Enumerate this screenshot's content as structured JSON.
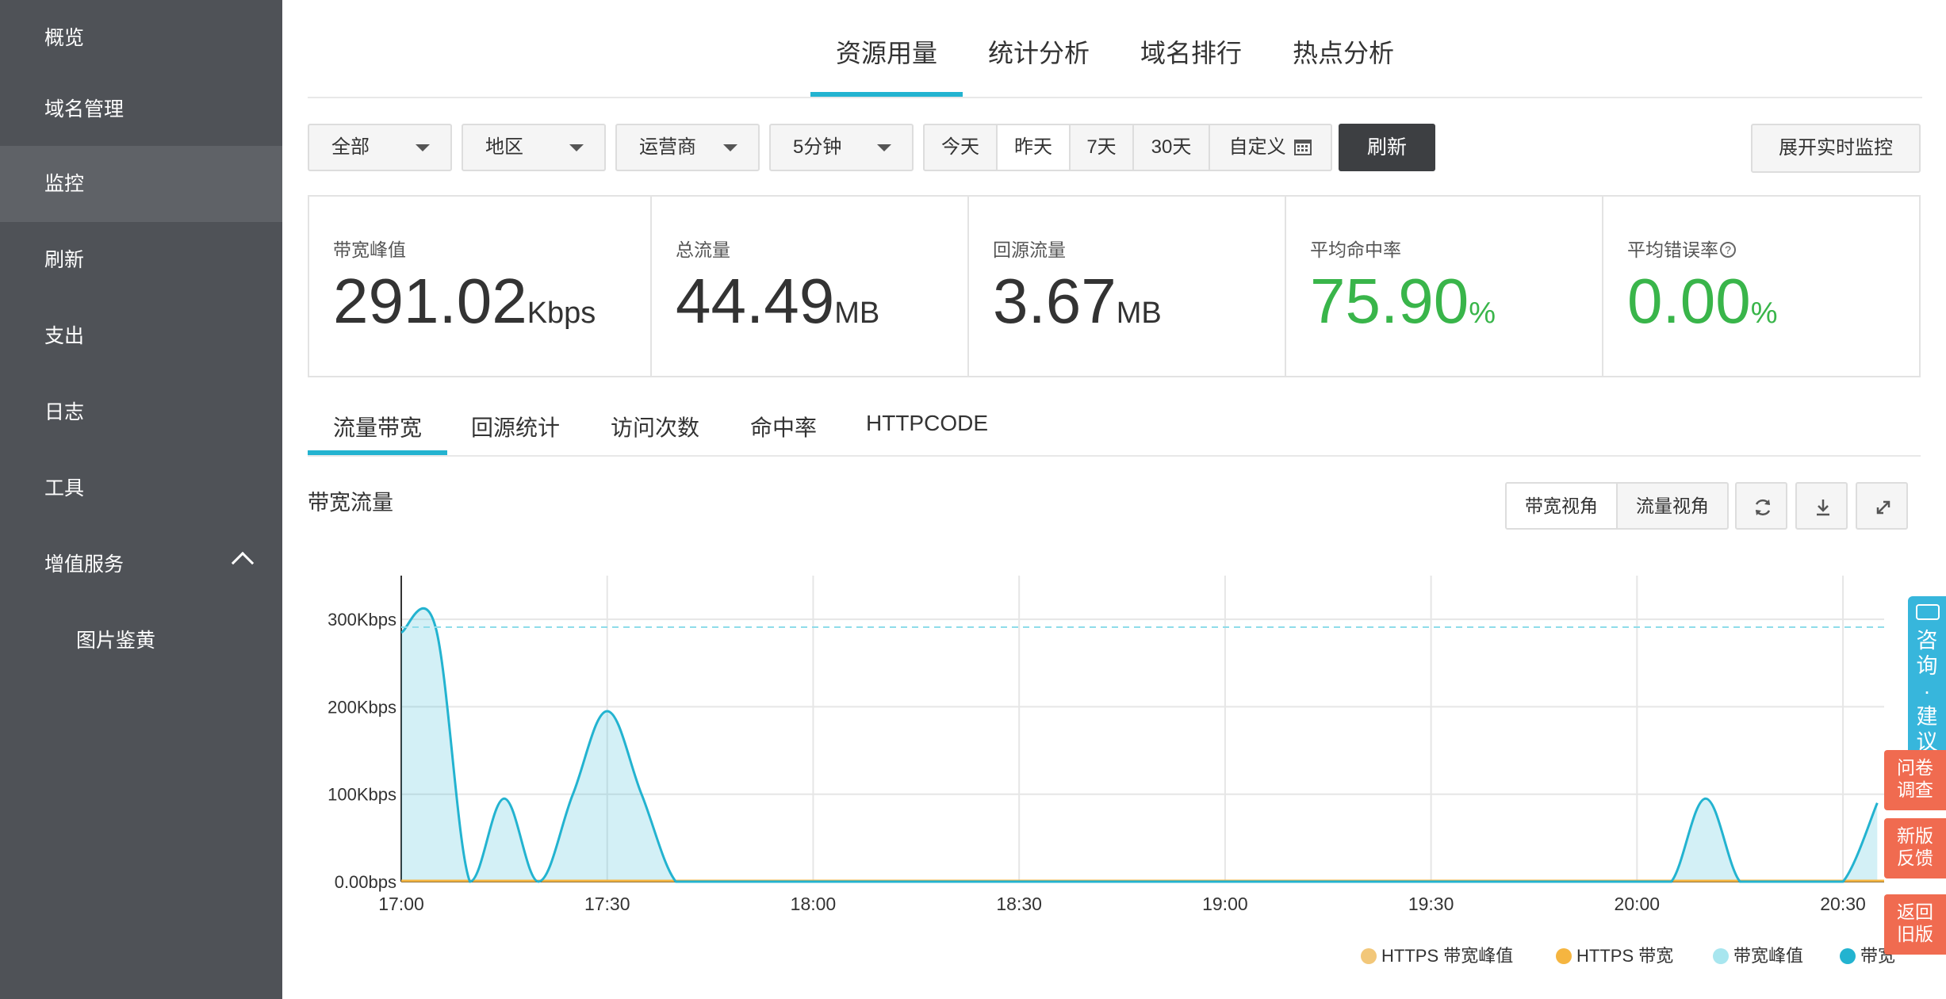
{
  "sidebar": {
    "items": [
      {
        "label": "概览"
      },
      {
        "label": "域名管理"
      },
      {
        "label": "监控"
      },
      {
        "label": "刷新"
      },
      {
        "label": "支出"
      },
      {
        "label": "日志"
      },
      {
        "label": "工具"
      },
      {
        "label": "增值服务"
      },
      {
        "label": "图片鉴黄"
      }
    ],
    "active_index": 2
  },
  "top_tabs": [
    {
      "label": "资源用量"
    },
    {
      "label": "统计分析"
    },
    {
      "label": "域名排行"
    },
    {
      "label": "热点分析"
    }
  ],
  "top_tabs_active_index": 0,
  "filters": {
    "scope": "全部",
    "region": "地区",
    "isp": "运营商",
    "interval": "5分钟"
  },
  "date_range": {
    "options": [
      "今天",
      "昨天",
      "7天",
      "30天",
      "自定义"
    ],
    "active_index": 1
  },
  "toolbar": {
    "refresh_label": "刷新",
    "realtime_label": "展开实时监控"
  },
  "stats": [
    {
      "label": "带宽峰值",
      "value": "291.02",
      "unit": "Kbps"
    },
    {
      "label": "总流量",
      "value": "44.49",
      "unit": "MB"
    },
    {
      "label": "回源流量",
      "value": "3.67",
      "unit": "MB"
    },
    {
      "label": "平均命中率",
      "value": "75.90",
      "unit": "%"
    },
    {
      "label": "平均错误率",
      "value": "0.00",
      "unit": "%"
    }
  ],
  "colors": {
    "accent": "#23b3d0",
    "good": "#39b54a",
    "sidebar_bg": "#4f5257",
    "sidebar_active_bg": "#5f6267",
    "consult_tab": "#37b6dc",
    "feedback_tab": "#f06b50"
  },
  "sub_tabs": [
    {
      "label": "流量带宽"
    },
    {
      "label": "回源统计"
    },
    {
      "label": "访问次数"
    },
    {
      "label": "命中率"
    },
    {
      "label": "HTTPCODE"
    }
  ],
  "sub_tabs_active_index": 0,
  "chart_section": {
    "title": "带宽流量",
    "view_buttons": [
      "带宽视角",
      "流量视角"
    ],
    "view_active_index": 0,
    "icons": [
      "refresh-icon",
      "download-icon",
      "fullscreen-icon"
    ]
  },
  "chart_data": {
    "type": "area",
    "title": "带宽流量",
    "xlabel": "",
    "ylabel": "",
    "x_ticks": [
      "17:00",
      "17:30",
      "18:00",
      "18:30",
      "19:00",
      "19:30",
      "20:00",
      "20:30"
    ],
    "y_ticks": [
      "0.00bps",
      "100Kbps",
      "200Kbps",
      "300Kbps"
    ],
    "ylim": [
      0,
      350
    ],
    "x_unit": "minutes after 17:00",
    "xlim": [
      0,
      216
    ],
    "grid": true,
    "legend_position": "bottom-right",
    "series": [
      {
        "name": "HTTPS 带宽峰值",
        "color": "#f2c779",
        "style": "dot",
        "values": []
      },
      {
        "name": "HTTPS 带宽",
        "color": "#f5b540",
        "style": "line",
        "x": [
          0,
          216
        ],
        "y": [
          0,
          0
        ]
      },
      {
        "name": "带宽峰值",
        "color": "#a8e6ef",
        "style": "dashed",
        "x": [
          0,
          216
        ],
        "y": [
          291.02,
          291.02
        ]
      },
      {
        "name": "带宽",
        "color": "#23b3d0",
        "style": "area",
        "x": [
          0,
          5,
          10,
          15,
          20,
          25,
          30,
          35,
          40,
          45,
          50,
          55,
          60,
          65,
          70,
          75,
          80,
          85,
          90,
          95,
          100,
          105,
          110,
          115,
          120,
          125,
          130,
          135,
          140,
          145,
          150,
          155,
          160,
          165,
          170,
          175,
          180,
          185,
          190,
          195,
          200,
          205,
          210,
          215
        ],
        "y": [
          285,
          291,
          0,
          95,
          0,
          100,
          195,
          100,
          0,
          0,
          0,
          0,
          0,
          0,
          0,
          0,
          0,
          0,
          0,
          0,
          0,
          0,
          0,
          0,
          0,
          0,
          0,
          0,
          0,
          0,
          0,
          0,
          0,
          0,
          0,
          0,
          0,
          0,
          95,
          0,
          0,
          0,
          0,
          90
        ]
      }
    ]
  },
  "float_tabs": {
    "consult": "咨询·建议",
    "survey": "问卷调查",
    "feedback": "新版反馈",
    "back_old": "返回旧版"
  }
}
